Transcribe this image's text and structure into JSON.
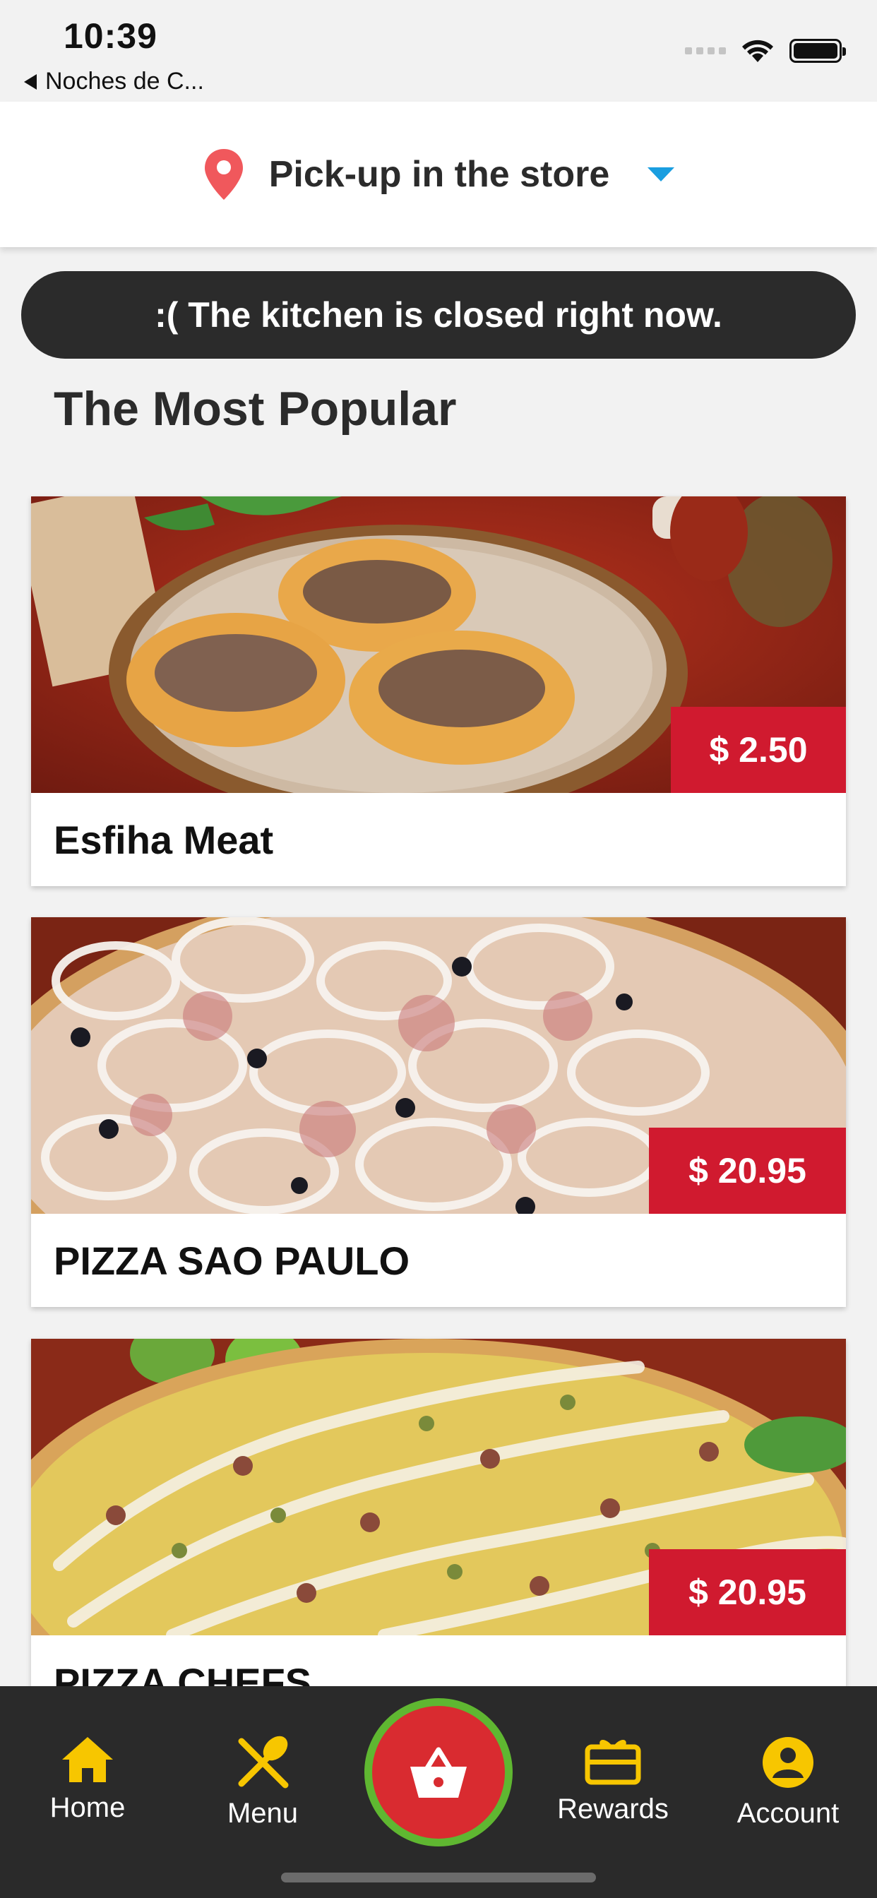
{
  "status_bar": {
    "time": "10:39",
    "back_app": "Noches de C..."
  },
  "header": {
    "pickup_label": "Pick-up in the store",
    "pin_color": "#f0585c",
    "caret_color": "#1a9ee0"
  },
  "banner": {
    "text": ":( The kitchen is closed right now."
  },
  "section": {
    "title": "The Most Popular"
  },
  "products": [
    {
      "name": "Esfiha Meat",
      "price": "$ 2.50"
    },
    {
      "name": "PIZZA SAO PAULO",
      "price": "$ 20.95"
    },
    {
      "name": "PIZZA CHEFS",
      "price": "$ 20.95"
    }
  ],
  "nav": {
    "home": "Home",
    "menu": "Menu",
    "rewards": "Rewards",
    "account": "Account",
    "icon_color": "#f7c600",
    "cart_color": "#d92b30",
    "cart_ring_color": "#5fb731"
  },
  "colors": {
    "price_bg": "#d01a2f",
    "banner_bg": "#2b2b2b"
  }
}
